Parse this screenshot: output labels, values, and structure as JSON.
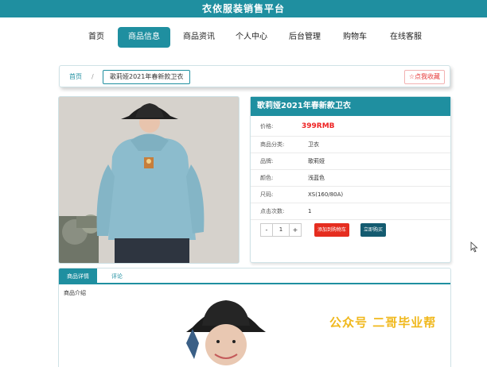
{
  "site": {
    "title": "衣依服装销售平台"
  },
  "nav": {
    "items": [
      {
        "label": "首页"
      },
      {
        "label": "商品信息"
      },
      {
        "label": "商品资讯"
      },
      {
        "label": "个人中心"
      },
      {
        "label": "后台管理"
      },
      {
        "label": "购物车"
      },
      {
        "label": "在线客服"
      }
    ],
    "active_index": 1
  },
  "breadcrumb": {
    "home": "首页",
    "separator": "/",
    "current": "歌莉娅2021年春新款卫衣"
  },
  "favorite": {
    "icon": "star-outline-icon",
    "label": "☆点我收藏"
  },
  "product": {
    "title": "歌莉娅2021年春新款卫衣",
    "price_label": "价格:",
    "price": "399RMB",
    "attributes": [
      {
        "label": "商品分类:",
        "value": "卫衣"
      },
      {
        "label": "品牌:",
        "value": "歌莉娅"
      },
      {
        "label": "颜色:",
        "value": "浅蓝色"
      },
      {
        "label": "尺码:",
        "value": "XS(160/80A)"
      },
      {
        "label": "点击次数:",
        "value": "1"
      }
    ],
    "quantity": "1",
    "minus_label": "-",
    "plus_label": "+",
    "add_to_cart_label": "添加到购物车",
    "buy_now_label": "立即购买"
  },
  "tabs": {
    "items": [
      {
        "label": "商品详情"
      },
      {
        "label": "评论"
      }
    ],
    "active_index": 0,
    "intro_label": "商品介绍"
  },
  "watermark": {
    "text": "公众号 二哥毕业帮"
  },
  "colors": {
    "primary": "#1f8fa0",
    "price": "#e22222",
    "cart": "#e52d1f",
    "buy": "#145b70",
    "watermark": "#f0b81c"
  }
}
